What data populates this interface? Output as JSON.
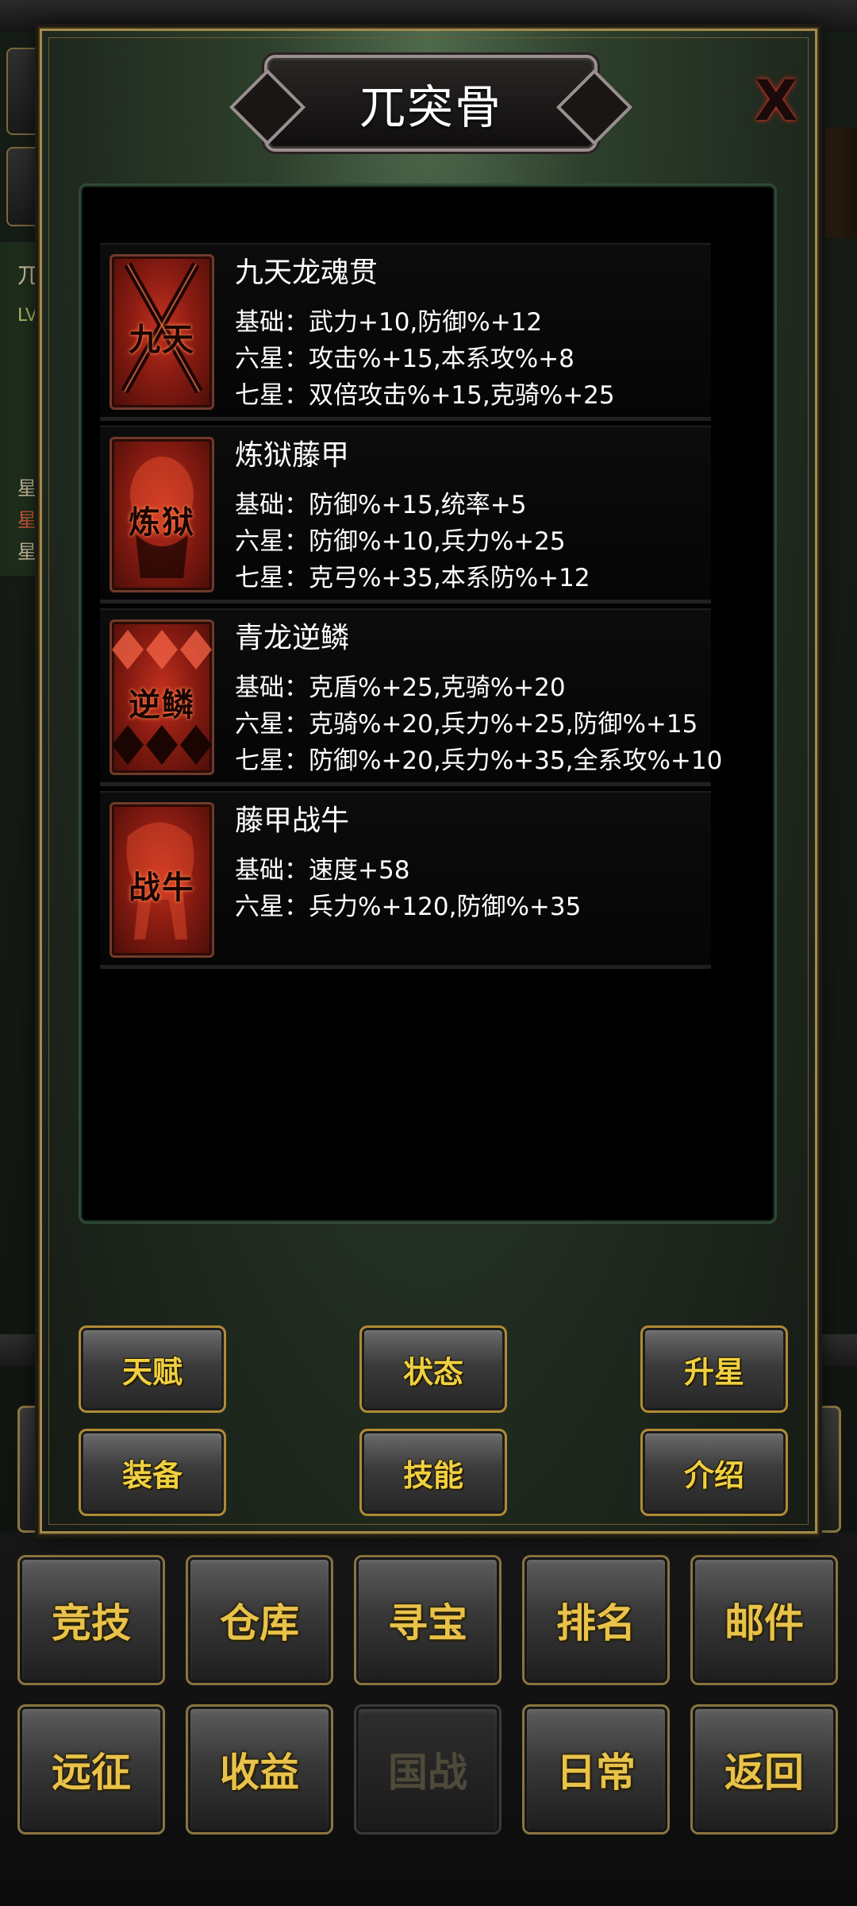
{
  "modal": {
    "title": "兀突骨",
    "close_glyph": "X",
    "tabs": [
      {
        "label": "天赋"
      },
      {
        "label": "状态"
      },
      {
        "label": "升星"
      },
      {
        "label": "装备"
      },
      {
        "label": "技能"
      },
      {
        "label": "介绍"
      }
    ]
  },
  "equipment": [
    {
      "icon_text": "九天",
      "icon": "crossed-swords-icon",
      "name": "九天龙魂贯",
      "stats": [
        "基础：武力+10,防御%+12",
        "六星：攻击%+15,本系攻%+8",
        "七星：双倍攻击%+15,克骑%+25"
      ]
    },
    {
      "icon_text": "炼狱",
      "icon": "rattan-armor-icon",
      "name": "炼狱藤甲",
      "stats": [
        "基础：防御%+15,统率+5",
        "六星：防御%+10,兵力%+25",
        "七星：克弓%+35,本系防%+12"
      ]
    },
    {
      "icon_text": "逆鳞",
      "icon": "dragon-scale-icon",
      "name": "青龙逆鳞",
      "stats": [
        "基础：克盾%+25,克骑%+20",
        "六星：克骑%+20,兵力%+25,防御%+15",
        "七星：防御%+20,兵力%+35,全系攻%+10"
      ]
    },
    {
      "icon_text": "战牛",
      "icon": "war-ox-icon",
      "name": "藤甲战牛",
      "stats": [
        "基础：速度+58",
        "六星：兵力%+120,防御%+35"
      ]
    }
  ],
  "bottom_menu": [
    {
      "label": "竞技",
      "enabled": true
    },
    {
      "label": "仓库",
      "enabled": true
    },
    {
      "label": "寻宝",
      "enabled": true
    },
    {
      "label": "排名",
      "enabled": true
    },
    {
      "label": "邮件",
      "enabled": true
    },
    {
      "label": "远征",
      "enabled": true
    },
    {
      "label": "收益",
      "enabled": true
    },
    {
      "label": "国战",
      "enabled": false
    },
    {
      "label": "日常",
      "enabled": true
    },
    {
      "label": "返回",
      "enabled": true
    }
  ],
  "background": {
    "left_panel_chars": [
      "兀",
      "LV",
      "星",
      "星",
      "星"
    ]
  },
  "colors": {
    "button_text": "#f0d040",
    "button_border": "#b08a35",
    "icon_red": "#c2301f",
    "panel_border": "#2f4a34"
  }
}
